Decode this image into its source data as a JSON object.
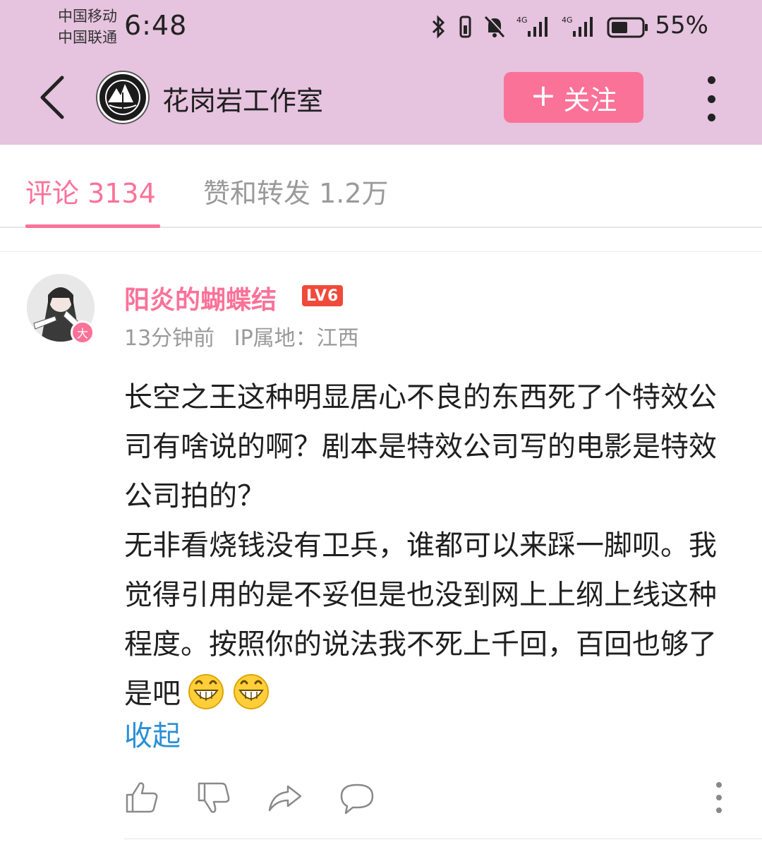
{
  "status_bar": {
    "carrier_1": "中国移动",
    "carrier_2": "中国联通",
    "time": "6:48",
    "battery_percent": "55%",
    "network_label_1": "4G",
    "network_label_2": "4G"
  },
  "header": {
    "title": "花岗岩工作室",
    "follow_plus": "+",
    "follow_label": "关注"
  },
  "tabs": [
    {
      "label": "评论 3134",
      "active": true
    },
    {
      "label": "赞和转发 1.2万",
      "active": false
    }
  ],
  "comment": {
    "username": "阳炎的蝴蝶结",
    "level": "LV6",
    "avatar_badge": "大",
    "time_ago": "13分钟前",
    "ip_location": "IP属地：江西",
    "paragraph_1": "长空之王这种明显居心不良的东西死了个特效公司有啥说的啊？剧本是特效公司写的电影是特效公司拍的？",
    "paragraph_2": "无非看烧钱没有卫兵，谁都可以来踩一脚呗。我觉得引用的是不妥但是也没到网上上纲上线这种程度。按照你的说法我不死上千回，百回也够了是吧",
    "collapse_label": "收起"
  },
  "colors": {
    "header_bg": "#e6c3df",
    "accent_pink": "#fb7299",
    "link_blue": "#2b8fd6",
    "level_red": "#f04a3a"
  },
  "icons": {
    "back": "chevron-left-icon",
    "more": "more-vertical-icon",
    "like": "thumbs-up-icon",
    "dislike": "thumbs-down-icon",
    "share": "share-icon",
    "reply": "comment-bubble-icon",
    "emoji": "grinning-face-icon"
  }
}
